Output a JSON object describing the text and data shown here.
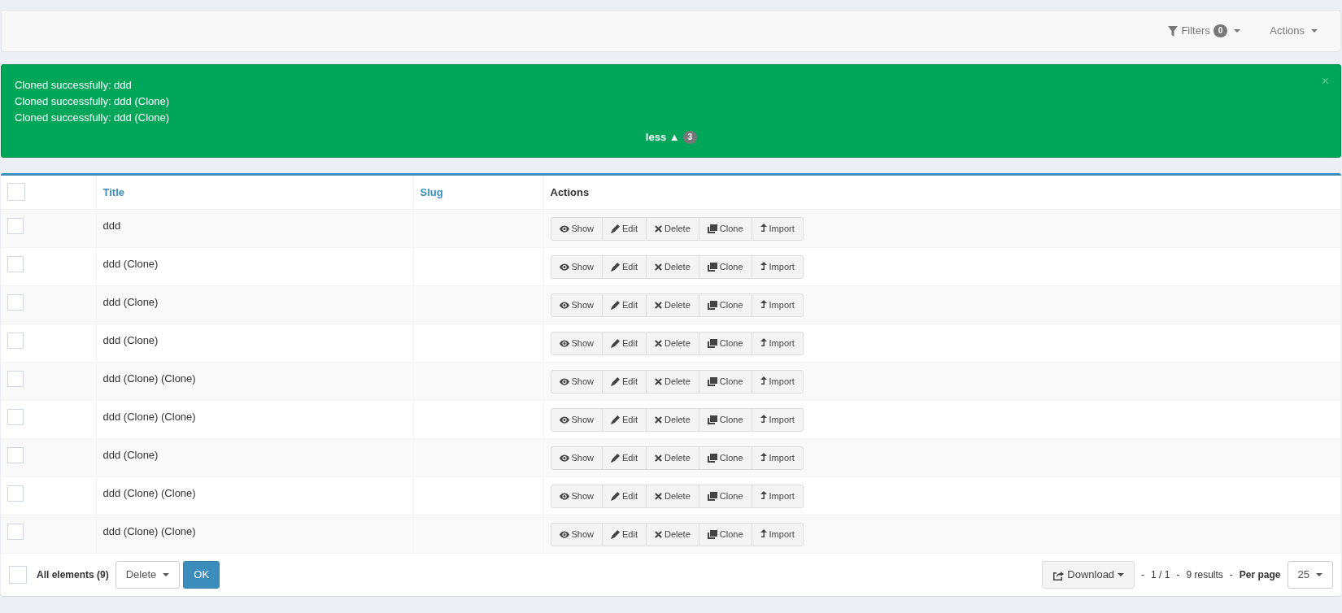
{
  "navbar": {
    "filters": {
      "label": "Filters",
      "count": "0"
    },
    "actions": {
      "label": "Actions"
    }
  },
  "alert": {
    "messages": [
      "Cloned successfully: ddd",
      "Cloned successfully: ddd (Clone)",
      "Cloned successfully: ddd (Clone)"
    ],
    "toggle": {
      "label": "less ▲",
      "count": "3"
    },
    "close": "×"
  },
  "table": {
    "columns": [
      {
        "label": "Title",
        "sortable": true
      },
      {
        "label": "Slug",
        "sortable": true
      },
      {
        "label": "Actions",
        "sortable": false
      }
    ],
    "header_checked": false,
    "rows": [
      {
        "title": "ddd",
        "checked": false,
        "actions": [
          {
            "kind": "show",
            "label": "Show"
          },
          {
            "kind": "edit",
            "label": "Edit"
          },
          {
            "kind": "delete",
            "label": "Delete"
          },
          {
            "kind": "clone",
            "label": "Clone"
          },
          {
            "kind": "import",
            "label": "Import"
          }
        ]
      },
      {
        "title": "ddd (Clone)",
        "checked": false,
        "actions": [
          {
            "kind": "show",
            "label": "Show"
          },
          {
            "kind": "edit",
            "label": "Edit"
          },
          {
            "kind": "delete",
            "label": "Delete"
          },
          {
            "kind": "clone",
            "label": "Clone"
          },
          {
            "kind": "import",
            "label": "Import"
          }
        ]
      },
      {
        "title": "ddd (Clone)",
        "checked": false,
        "actions": [
          {
            "kind": "show",
            "label": "Show"
          },
          {
            "kind": "edit",
            "label": "Edit"
          },
          {
            "kind": "delete",
            "label": "Delete"
          },
          {
            "kind": "clone",
            "label": "Clone"
          },
          {
            "kind": "import",
            "label": "Import"
          }
        ]
      },
      {
        "title": "ddd (Clone)",
        "checked": false,
        "actions": [
          {
            "kind": "show",
            "label": "Show"
          },
          {
            "kind": "edit",
            "label": "Edit"
          },
          {
            "kind": "delete",
            "label": "Delete"
          },
          {
            "kind": "clone",
            "label": "Clone"
          },
          {
            "kind": "import",
            "label": "Import"
          }
        ]
      },
      {
        "title": "ddd (Clone) (Clone)",
        "checked": false,
        "actions": [
          {
            "kind": "show",
            "label": "Show"
          },
          {
            "kind": "edit",
            "label": "Edit"
          },
          {
            "kind": "delete",
            "label": "Delete"
          },
          {
            "kind": "clone",
            "label": "Clone"
          },
          {
            "kind": "import",
            "label": "Import"
          }
        ]
      },
      {
        "title": "ddd (Clone) (Clone)",
        "checked": false,
        "actions": [
          {
            "kind": "show",
            "label": "Show"
          },
          {
            "kind": "edit",
            "label": "Edit"
          },
          {
            "kind": "delete",
            "label": "Delete"
          },
          {
            "kind": "clone",
            "label": "Clone"
          },
          {
            "kind": "import",
            "label": "Import"
          }
        ]
      },
      {
        "title": "ddd (Clone)",
        "checked": false,
        "actions": [
          {
            "kind": "show",
            "label": "Show"
          },
          {
            "kind": "edit",
            "label": "Edit"
          },
          {
            "kind": "delete",
            "label": "Delete"
          },
          {
            "kind": "clone",
            "label": "Clone"
          },
          {
            "kind": "import",
            "label": "Import"
          }
        ]
      },
      {
        "title": "ddd (Clone) (Clone)",
        "checked": false,
        "actions": [
          {
            "kind": "show",
            "label": "Show"
          },
          {
            "kind": "edit",
            "label": "Edit"
          },
          {
            "kind": "delete",
            "label": "Delete"
          },
          {
            "kind": "clone",
            "label": "Clone"
          },
          {
            "kind": "import",
            "label": "Import"
          }
        ]
      },
      {
        "title": "ddd (Clone) (Clone)",
        "checked": false,
        "actions": [
          {
            "kind": "show",
            "label": "Show"
          },
          {
            "kind": "edit",
            "label": "Edit"
          },
          {
            "kind": "delete",
            "label": "Delete"
          },
          {
            "kind": "clone",
            "label": "Clone"
          },
          {
            "kind": "import",
            "label": "Import"
          }
        ]
      }
    ]
  },
  "footer": {
    "all_checked": false,
    "all_label": "All elements (9)",
    "batch_action": "Delete",
    "ok": "OK",
    "download": "Download",
    "pager": "1 / 1",
    "results": "9 results",
    "separator": "-",
    "per_page_label": "Per page",
    "per_page": "25"
  }
}
